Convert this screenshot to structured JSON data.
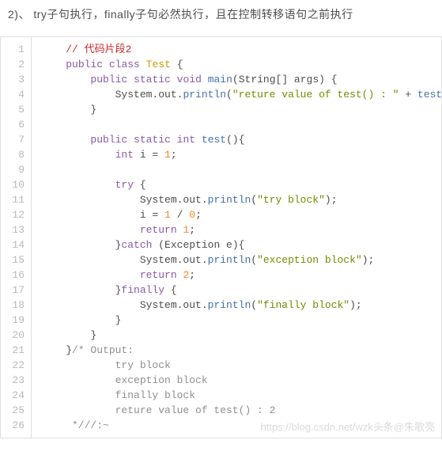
{
  "heading": "2)、 try子句执行，finally子句必然执行，且在控制转移语句之前执行",
  "watermark": "https://blog.csdn.net/wzk头条@朱歌亮",
  "lines": [
    "1",
    "2",
    "3",
    "4",
    "5",
    "6",
    "7",
    "8",
    "9",
    "10",
    "11",
    "12",
    "13",
    "14",
    "15",
    "16",
    "17",
    "18",
    "19",
    "20",
    "21",
    "22",
    "23",
    "24",
    "25",
    "26"
  ],
  "code": [
    [
      {
        "t": "    ",
        "c": "pn"
      },
      {
        "t": "// 代码片段2",
        "c": "cr"
      }
    ],
    [
      {
        "t": "    ",
        "c": "pn"
      },
      {
        "t": "public",
        "c": "kw"
      },
      {
        "t": " ",
        "c": "pn"
      },
      {
        "t": "class",
        "c": "kw"
      },
      {
        "t": " ",
        "c": "pn"
      },
      {
        "t": "Test",
        "c": "cn"
      },
      {
        "t": " {",
        "c": "pn"
      }
    ],
    [
      {
        "t": "        ",
        "c": "pn"
      },
      {
        "t": "public",
        "c": "kw"
      },
      {
        "t": " ",
        "c": "pn"
      },
      {
        "t": "static",
        "c": "kw"
      },
      {
        "t": " ",
        "c": "pn"
      },
      {
        "t": "void",
        "c": "kw"
      },
      {
        "t": " ",
        "c": "pn"
      },
      {
        "t": "main",
        "c": "fn"
      },
      {
        "t": "(String[] args) {",
        "c": "pn"
      }
    ],
    [
      {
        "t": "            System.out.",
        "c": "pn"
      },
      {
        "t": "println",
        "c": "fn"
      },
      {
        "t": "(",
        "c": "pn"
      },
      {
        "t": "\"reture value of test() : \"",
        "c": "st"
      },
      {
        "t": " + ",
        "c": "pn"
      },
      {
        "t": "test",
        "c": "fn"
      },
      {
        "t": "());",
        "c": "pn"
      }
    ],
    [
      {
        "t": "        }",
        "c": "pn"
      }
    ],
    [
      {
        "t": " ",
        "c": "pn"
      }
    ],
    [
      {
        "t": "        ",
        "c": "pn"
      },
      {
        "t": "public",
        "c": "kw"
      },
      {
        "t": " ",
        "c": "pn"
      },
      {
        "t": "static",
        "c": "kw"
      },
      {
        "t": " ",
        "c": "pn"
      },
      {
        "t": "int",
        "c": "kw"
      },
      {
        "t": " ",
        "c": "pn"
      },
      {
        "t": "test",
        "c": "fn"
      },
      {
        "t": "(){",
        "c": "pn"
      }
    ],
    [
      {
        "t": "            ",
        "c": "pn"
      },
      {
        "t": "int",
        "c": "kw"
      },
      {
        "t": " i = ",
        "c": "pn"
      },
      {
        "t": "1",
        "c": "nm"
      },
      {
        "t": ";",
        "c": "pn"
      }
    ],
    [
      {
        "t": " ",
        "c": "pn"
      }
    ],
    [
      {
        "t": "            ",
        "c": "pn"
      },
      {
        "t": "try",
        "c": "kw"
      },
      {
        "t": " {",
        "c": "pn"
      }
    ],
    [
      {
        "t": "                System.out.",
        "c": "pn"
      },
      {
        "t": "println",
        "c": "fn"
      },
      {
        "t": "(",
        "c": "pn"
      },
      {
        "t": "\"try block\"",
        "c": "st"
      },
      {
        "t": ");",
        "c": "pn"
      }
    ],
    [
      {
        "t": "                i = ",
        "c": "pn"
      },
      {
        "t": "1",
        "c": "nm"
      },
      {
        "t": " / ",
        "c": "pn"
      },
      {
        "t": "0",
        "c": "nm"
      },
      {
        "t": ";",
        "c": "pn"
      }
    ],
    [
      {
        "t": "                ",
        "c": "pn"
      },
      {
        "t": "return",
        "c": "kw"
      },
      {
        "t": " ",
        "c": "pn"
      },
      {
        "t": "1",
        "c": "nm"
      },
      {
        "t": ";",
        "c": "pn"
      }
    ],
    [
      {
        "t": "            }",
        "c": "pn"
      },
      {
        "t": "catch",
        "c": "kw"
      },
      {
        "t": " (Exception e){",
        "c": "pn"
      }
    ],
    [
      {
        "t": "                System.out.",
        "c": "pn"
      },
      {
        "t": "println",
        "c": "fn"
      },
      {
        "t": "(",
        "c": "pn"
      },
      {
        "t": "\"exception block\"",
        "c": "st"
      },
      {
        "t": ");",
        "c": "pn"
      }
    ],
    [
      {
        "t": "                ",
        "c": "pn"
      },
      {
        "t": "return",
        "c": "kw"
      },
      {
        "t": " ",
        "c": "pn"
      },
      {
        "t": "2",
        "c": "nm"
      },
      {
        "t": ";",
        "c": "pn"
      }
    ],
    [
      {
        "t": "            }",
        "c": "pn"
      },
      {
        "t": "finally",
        "c": "kw"
      },
      {
        "t": " {",
        "c": "pn"
      }
    ],
    [
      {
        "t": "                System.out.",
        "c": "pn"
      },
      {
        "t": "println",
        "c": "fn"
      },
      {
        "t": "(",
        "c": "pn"
      },
      {
        "t": "\"finally block\"",
        "c": "st"
      },
      {
        "t": ");",
        "c": "pn"
      }
    ],
    [
      {
        "t": "            }",
        "c": "pn"
      }
    ],
    [
      {
        "t": "        }",
        "c": "pn"
      }
    ],
    [
      {
        "t": "    }",
        "c": "pn"
      },
      {
        "t": "/* Output: ",
        "c": "cm"
      }
    ],
    [
      {
        "t": "            try block ",
        "c": "cm"
      }
    ],
    [
      {
        "t": "            exception block ",
        "c": "cm"
      }
    ],
    [
      {
        "t": "            finally block ",
        "c": "cm"
      }
    ],
    [
      {
        "t": "            reture value of test() : 2 ",
        "c": "cm"
      }
    ],
    [
      {
        "t": "     *///:~",
        "c": "cm"
      }
    ]
  ]
}
